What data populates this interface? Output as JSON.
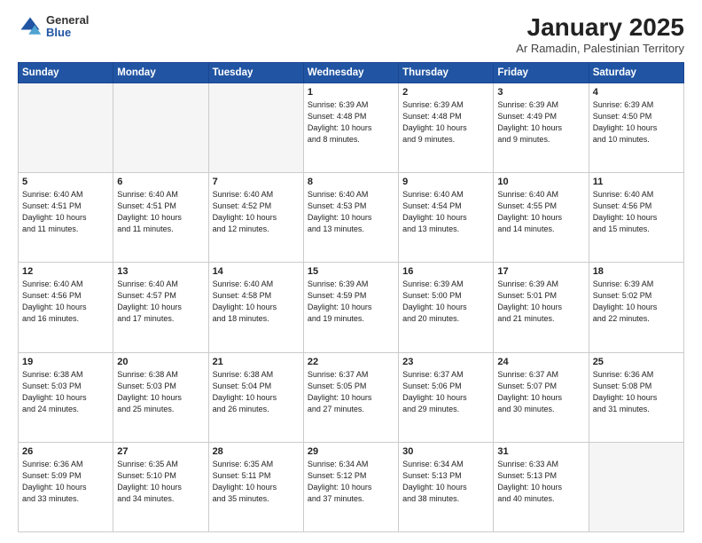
{
  "header": {
    "logo_general": "General",
    "logo_blue": "Blue",
    "title": "January 2025",
    "subtitle": "Ar Ramadin, Palestinian Territory"
  },
  "days_of_week": [
    "Sunday",
    "Monday",
    "Tuesday",
    "Wednesday",
    "Thursday",
    "Friday",
    "Saturday"
  ],
  "weeks": [
    [
      {
        "num": "",
        "info": "",
        "empty": true
      },
      {
        "num": "",
        "info": "",
        "empty": true
      },
      {
        "num": "",
        "info": "",
        "empty": true
      },
      {
        "num": "1",
        "info": "Sunrise: 6:39 AM\nSunset: 4:48 PM\nDaylight: 10 hours\nand 8 minutes.",
        "empty": false
      },
      {
        "num": "2",
        "info": "Sunrise: 6:39 AM\nSunset: 4:48 PM\nDaylight: 10 hours\nand 9 minutes.",
        "empty": false
      },
      {
        "num": "3",
        "info": "Sunrise: 6:39 AM\nSunset: 4:49 PM\nDaylight: 10 hours\nand 9 minutes.",
        "empty": false
      },
      {
        "num": "4",
        "info": "Sunrise: 6:39 AM\nSunset: 4:50 PM\nDaylight: 10 hours\nand 10 minutes.",
        "empty": false
      }
    ],
    [
      {
        "num": "5",
        "info": "Sunrise: 6:40 AM\nSunset: 4:51 PM\nDaylight: 10 hours\nand 11 minutes.",
        "empty": false
      },
      {
        "num": "6",
        "info": "Sunrise: 6:40 AM\nSunset: 4:51 PM\nDaylight: 10 hours\nand 11 minutes.",
        "empty": false
      },
      {
        "num": "7",
        "info": "Sunrise: 6:40 AM\nSunset: 4:52 PM\nDaylight: 10 hours\nand 12 minutes.",
        "empty": false
      },
      {
        "num": "8",
        "info": "Sunrise: 6:40 AM\nSunset: 4:53 PM\nDaylight: 10 hours\nand 13 minutes.",
        "empty": false
      },
      {
        "num": "9",
        "info": "Sunrise: 6:40 AM\nSunset: 4:54 PM\nDaylight: 10 hours\nand 13 minutes.",
        "empty": false
      },
      {
        "num": "10",
        "info": "Sunrise: 6:40 AM\nSunset: 4:55 PM\nDaylight: 10 hours\nand 14 minutes.",
        "empty": false
      },
      {
        "num": "11",
        "info": "Sunrise: 6:40 AM\nSunset: 4:56 PM\nDaylight: 10 hours\nand 15 minutes.",
        "empty": false
      }
    ],
    [
      {
        "num": "12",
        "info": "Sunrise: 6:40 AM\nSunset: 4:56 PM\nDaylight: 10 hours\nand 16 minutes.",
        "empty": false
      },
      {
        "num": "13",
        "info": "Sunrise: 6:40 AM\nSunset: 4:57 PM\nDaylight: 10 hours\nand 17 minutes.",
        "empty": false
      },
      {
        "num": "14",
        "info": "Sunrise: 6:40 AM\nSunset: 4:58 PM\nDaylight: 10 hours\nand 18 minutes.",
        "empty": false
      },
      {
        "num": "15",
        "info": "Sunrise: 6:39 AM\nSunset: 4:59 PM\nDaylight: 10 hours\nand 19 minutes.",
        "empty": false
      },
      {
        "num": "16",
        "info": "Sunrise: 6:39 AM\nSunset: 5:00 PM\nDaylight: 10 hours\nand 20 minutes.",
        "empty": false
      },
      {
        "num": "17",
        "info": "Sunrise: 6:39 AM\nSunset: 5:01 PM\nDaylight: 10 hours\nand 21 minutes.",
        "empty": false
      },
      {
        "num": "18",
        "info": "Sunrise: 6:39 AM\nSunset: 5:02 PM\nDaylight: 10 hours\nand 22 minutes.",
        "empty": false
      }
    ],
    [
      {
        "num": "19",
        "info": "Sunrise: 6:38 AM\nSunset: 5:03 PM\nDaylight: 10 hours\nand 24 minutes.",
        "empty": false
      },
      {
        "num": "20",
        "info": "Sunrise: 6:38 AM\nSunset: 5:03 PM\nDaylight: 10 hours\nand 25 minutes.",
        "empty": false
      },
      {
        "num": "21",
        "info": "Sunrise: 6:38 AM\nSunset: 5:04 PM\nDaylight: 10 hours\nand 26 minutes.",
        "empty": false
      },
      {
        "num": "22",
        "info": "Sunrise: 6:37 AM\nSunset: 5:05 PM\nDaylight: 10 hours\nand 27 minutes.",
        "empty": false
      },
      {
        "num": "23",
        "info": "Sunrise: 6:37 AM\nSunset: 5:06 PM\nDaylight: 10 hours\nand 29 minutes.",
        "empty": false
      },
      {
        "num": "24",
        "info": "Sunrise: 6:37 AM\nSunset: 5:07 PM\nDaylight: 10 hours\nand 30 minutes.",
        "empty": false
      },
      {
        "num": "25",
        "info": "Sunrise: 6:36 AM\nSunset: 5:08 PM\nDaylight: 10 hours\nand 31 minutes.",
        "empty": false
      }
    ],
    [
      {
        "num": "26",
        "info": "Sunrise: 6:36 AM\nSunset: 5:09 PM\nDaylight: 10 hours\nand 33 minutes.",
        "empty": false
      },
      {
        "num": "27",
        "info": "Sunrise: 6:35 AM\nSunset: 5:10 PM\nDaylight: 10 hours\nand 34 minutes.",
        "empty": false
      },
      {
        "num": "28",
        "info": "Sunrise: 6:35 AM\nSunset: 5:11 PM\nDaylight: 10 hours\nand 35 minutes.",
        "empty": false
      },
      {
        "num": "29",
        "info": "Sunrise: 6:34 AM\nSunset: 5:12 PM\nDaylight: 10 hours\nand 37 minutes.",
        "empty": false
      },
      {
        "num": "30",
        "info": "Sunrise: 6:34 AM\nSunset: 5:13 PM\nDaylight: 10 hours\nand 38 minutes.",
        "empty": false
      },
      {
        "num": "31",
        "info": "Sunrise: 6:33 AM\nSunset: 5:13 PM\nDaylight: 10 hours\nand 40 minutes.",
        "empty": false
      },
      {
        "num": "",
        "info": "",
        "empty": true
      }
    ]
  ],
  "colors": {
    "header_bg": "#2155a3",
    "header_text": "#ffffff",
    "empty_cell": "#f0f0f0"
  }
}
